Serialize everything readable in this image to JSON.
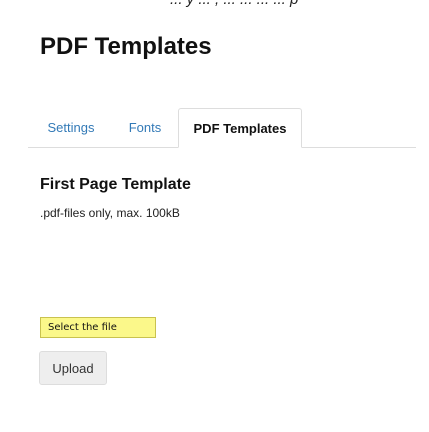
{
  "header": {
    "top_fragment": "... y ... , ... ... ... ... p",
    "title": "PDF Templates"
  },
  "tabs": [
    {
      "label": "Settings",
      "active": false
    },
    {
      "label": "Fonts",
      "active": false
    },
    {
      "label": "PDF Templates",
      "active": true
    }
  ],
  "section": {
    "title": "First Page Template",
    "note": ".pdf-files only, max. 100kB"
  },
  "file_input": {
    "label": "Select the file",
    "highlight_color": "#fbf88a"
  },
  "actions": {
    "upload_label": "Upload"
  },
  "colors": {
    "tab_link": "#337ab7",
    "tab_border": "#dddddd"
  }
}
